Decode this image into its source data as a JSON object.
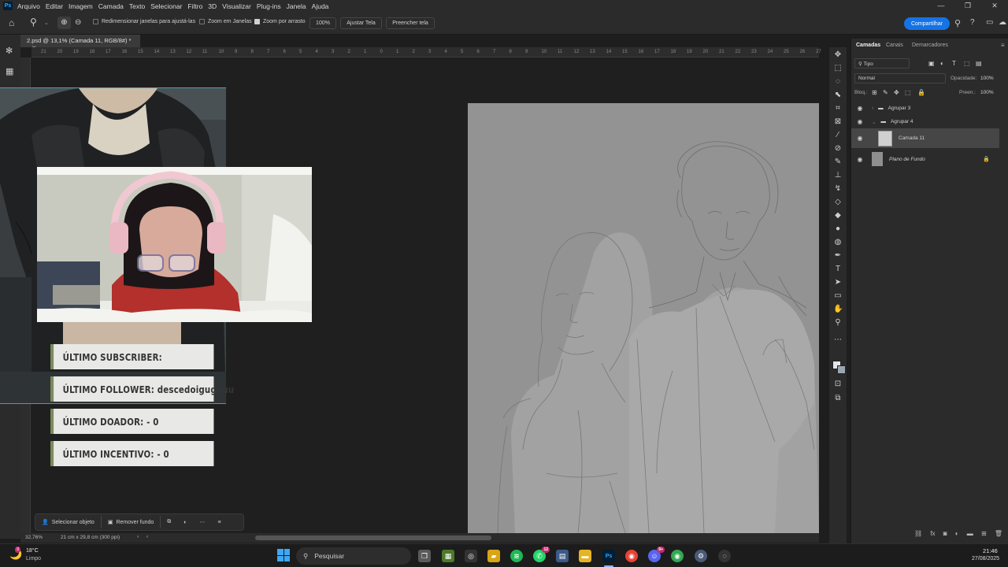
{
  "menu": [
    "Arquivo",
    "Editar",
    "Imagem",
    "Camada",
    "Texto",
    "Selecionar",
    "Filtro",
    "3D",
    "Visualizar",
    "Plug-ins",
    "Janela",
    "Ajuda"
  ],
  "app_icon": "Ps",
  "options": {
    "resize_windows": "Redimensionar janelas para ajustá-las",
    "zoom_all": "Zoom em Janelas",
    "scrubby_zoom": "Zoom por arrasto",
    "zoom_value": "100%",
    "fit_screen": "Ajustar Tela",
    "fill_screen": "Preencher tela",
    "share": "Compartilhar"
  },
  "document": {
    "tab_title": "2.psd @ 13,1% (Camada 11, RGB/8#) *"
  },
  "ruler_ticks": [
    "21",
    "20",
    "19",
    "18",
    "17",
    "16",
    "15",
    "14",
    "13",
    "12",
    "11",
    "10",
    "9",
    "8",
    "7",
    "6",
    "5",
    "4",
    "3",
    "2",
    "1",
    "0",
    "1",
    "2",
    "3",
    "4",
    "5",
    "6",
    "7",
    "8",
    "9",
    "10",
    "11",
    "12",
    "13",
    "14",
    "15",
    "16",
    "17",
    "18",
    "19",
    "20",
    "21",
    "22",
    "23",
    "24",
    "25",
    "26",
    "27"
  ],
  "stream_bars": [
    "ÚLTIMO SUBSCRIBER:",
    "ÚLTIMO FOLLOWER: descedoiguguuu",
    "ÚLTIMO DOADOR:  -  0",
    "ÚLTIMO INCENTIVO:  - 0"
  ],
  "context_bar": {
    "select_subject": "Selecionar objeto",
    "remove_bg": "Remover fundo"
  },
  "status": {
    "zoom": "32,76%",
    "doc_size": "21 cm x 29,8 cm (300 ppi)"
  },
  "layers_panel": {
    "tabs": [
      "Camadas",
      "Canais",
      "Demarcadores"
    ],
    "filter": "Tipo",
    "blend_mode": "Normal",
    "opacity_label": "Opacidade:",
    "opacity_value": "100%",
    "lock_label": "Bloq.:",
    "fill_label": "Preen.:",
    "fill_value": "100%",
    "layers": [
      {
        "name": "Agrupar 3",
        "type": "group"
      },
      {
        "name": "Agrupar 4",
        "type": "group"
      },
      {
        "name": "Camada 11",
        "type": "layer"
      },
      {
        "name": "Plano de Fundo",
        "type": "background"
      }
    ]
  },
  "taskbar": {
    "weather_temp": "18°C",
    "weather_desc": "Limpo",
    "weather_badge": "9",
    "search_placeholder": "Pesquisar",
    "whatsapp_badge": "12",
    "discord_badge": "9+",
    "time": "21:46",
    "date": "27/08/2025"
  },
  "colors": {
    "accent": "#1473e6",
    "bar_accent": "#7b8a5c",
    "cam_border": "#3aa0c0"
  }
}
